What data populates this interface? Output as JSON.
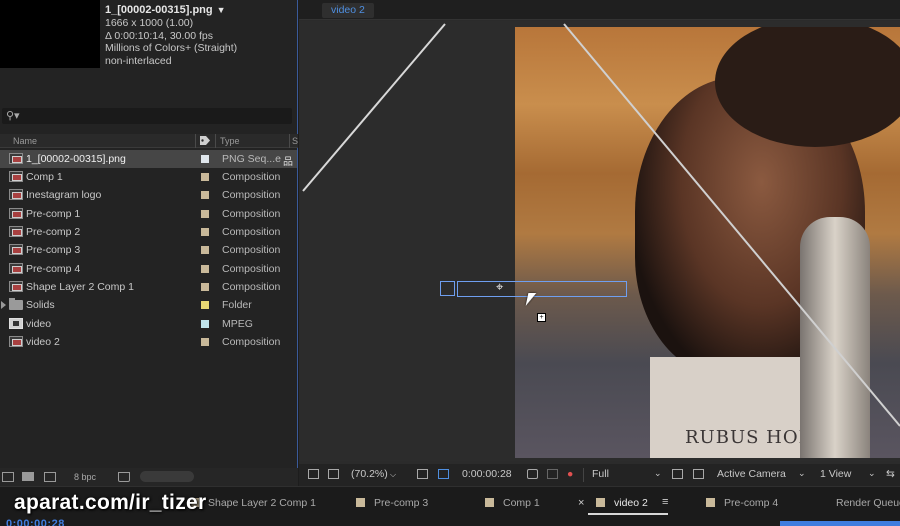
{
  "project": {
    "file_title": "1_[00002-00315].png",
    "info": {
      "dimensions": "1666 x 1000 (1.00)",
      "duration": "Δ 0:00:10:14, 30.00 fps",
      "colors": "Millions of Colors+ (Straight)",
      "interlace": "non-interlaced"
    },
    "columns": {
      "name": "Name",
      "type": "Type",
      "size": "S"
    },
    "items": [
      {
        "name": "1_[00002-00315].png",
        "type": "PNG Seq...e",
        "kind": "image-sequence",
        "selected": true
      },
      {
        "name": "Comp 1",
        "type": "Composition",
        "kind": "composition"
      },
      {
        "name": "Inestagram logo",
        "type": "Composition",
        "kind": "composition"
      },
      {
        "name": "Pre-comp 1",
        "type": "Composition",
        "kind": "composition"
      },
      {
        "name": "Pre-comp 2",
        "type": "Composition",
        "kind": "composition"
      },
      {
        "name": "Pre-comp 3",
        "type": "Composition",
        "kind": "composition"
      },
      {
        "name": "Pre-comp 4",
        "type": "Composition",
        "kind": "composition"
      },
      {
        "name": "Shape Layer 2 Comp 1",
        "type": "Composition",
        "kind": "composition"
      },
      {
        "name": "Solids",
        "type": "Folder",
        "kind": "folder",
        "label_color": "#e8d873"
      },
      {
        "name": "video",
        "type": "MPEG",
        "kind": "footage",
        "label_color": "#bfe3ea"
      },
      {
        "name": "video 2",
        "type": "Composition",
        "kind": "composition"
      }
    ],
    "bpc": "8 bpc"
  },
  "viewer": {
    "tab": "video 2",
    "shirt_print": "RUBUS HOB",
    "zoom": "(70.2%)",
    "timecode": "0:00:00:28",
    "resolution": "Full",
    "camera": "Active Camera",
    "views": "1 View"
  },
  "tabs": [
    {
      "label": "Shape Layer 2 Comp 1",
      "active": false
    },
    {
      "label": "Pre-comp 3",
      "active": false
    },
    {
      "label": "Comp 1",
      "active": false
    },
    {
      "label": "video 2",
      "active": true
    },
    {
      "label": "Pre-comp 4",
      "active": false
    },
    {
      "label": "Render Queue",
      "active": false
    }
  ],
  "timeline": {
    "timecode": "0:00:00:28"
  },
  "watermark": "aparat.com/ir_tizer",
  "colors": {
    "accent": "#3f7de0",
    "composition_label": "#c9b99a",
    "panel_bg": "#232323"
  }
}
